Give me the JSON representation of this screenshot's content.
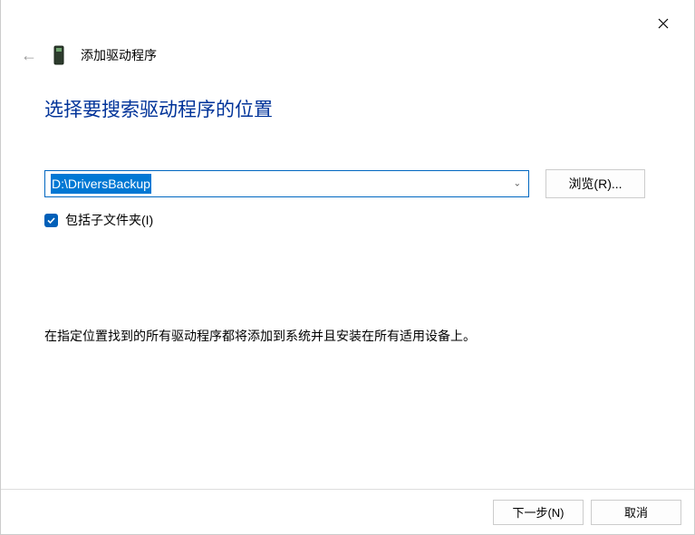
{
  "header": {
    "title": "添加驱动程序"
  },
  "main": {
    "heading": "选择要搜索驱动程序的位置",
    "path_value": "D:\\DriversBackup",
    "browse_label": "浏览(R)...",
    "include_sub_label": "包括子文件夹(I)",
    "include_sub_checked": true,
    "description": "在指定位置找到的所有驱动程序都将添加到系统并且安装在所有适用设备上。"
  },
  "footer": {
    "next_label": "下一步(N)",
    "cancel_label": "取消"
  }
}
